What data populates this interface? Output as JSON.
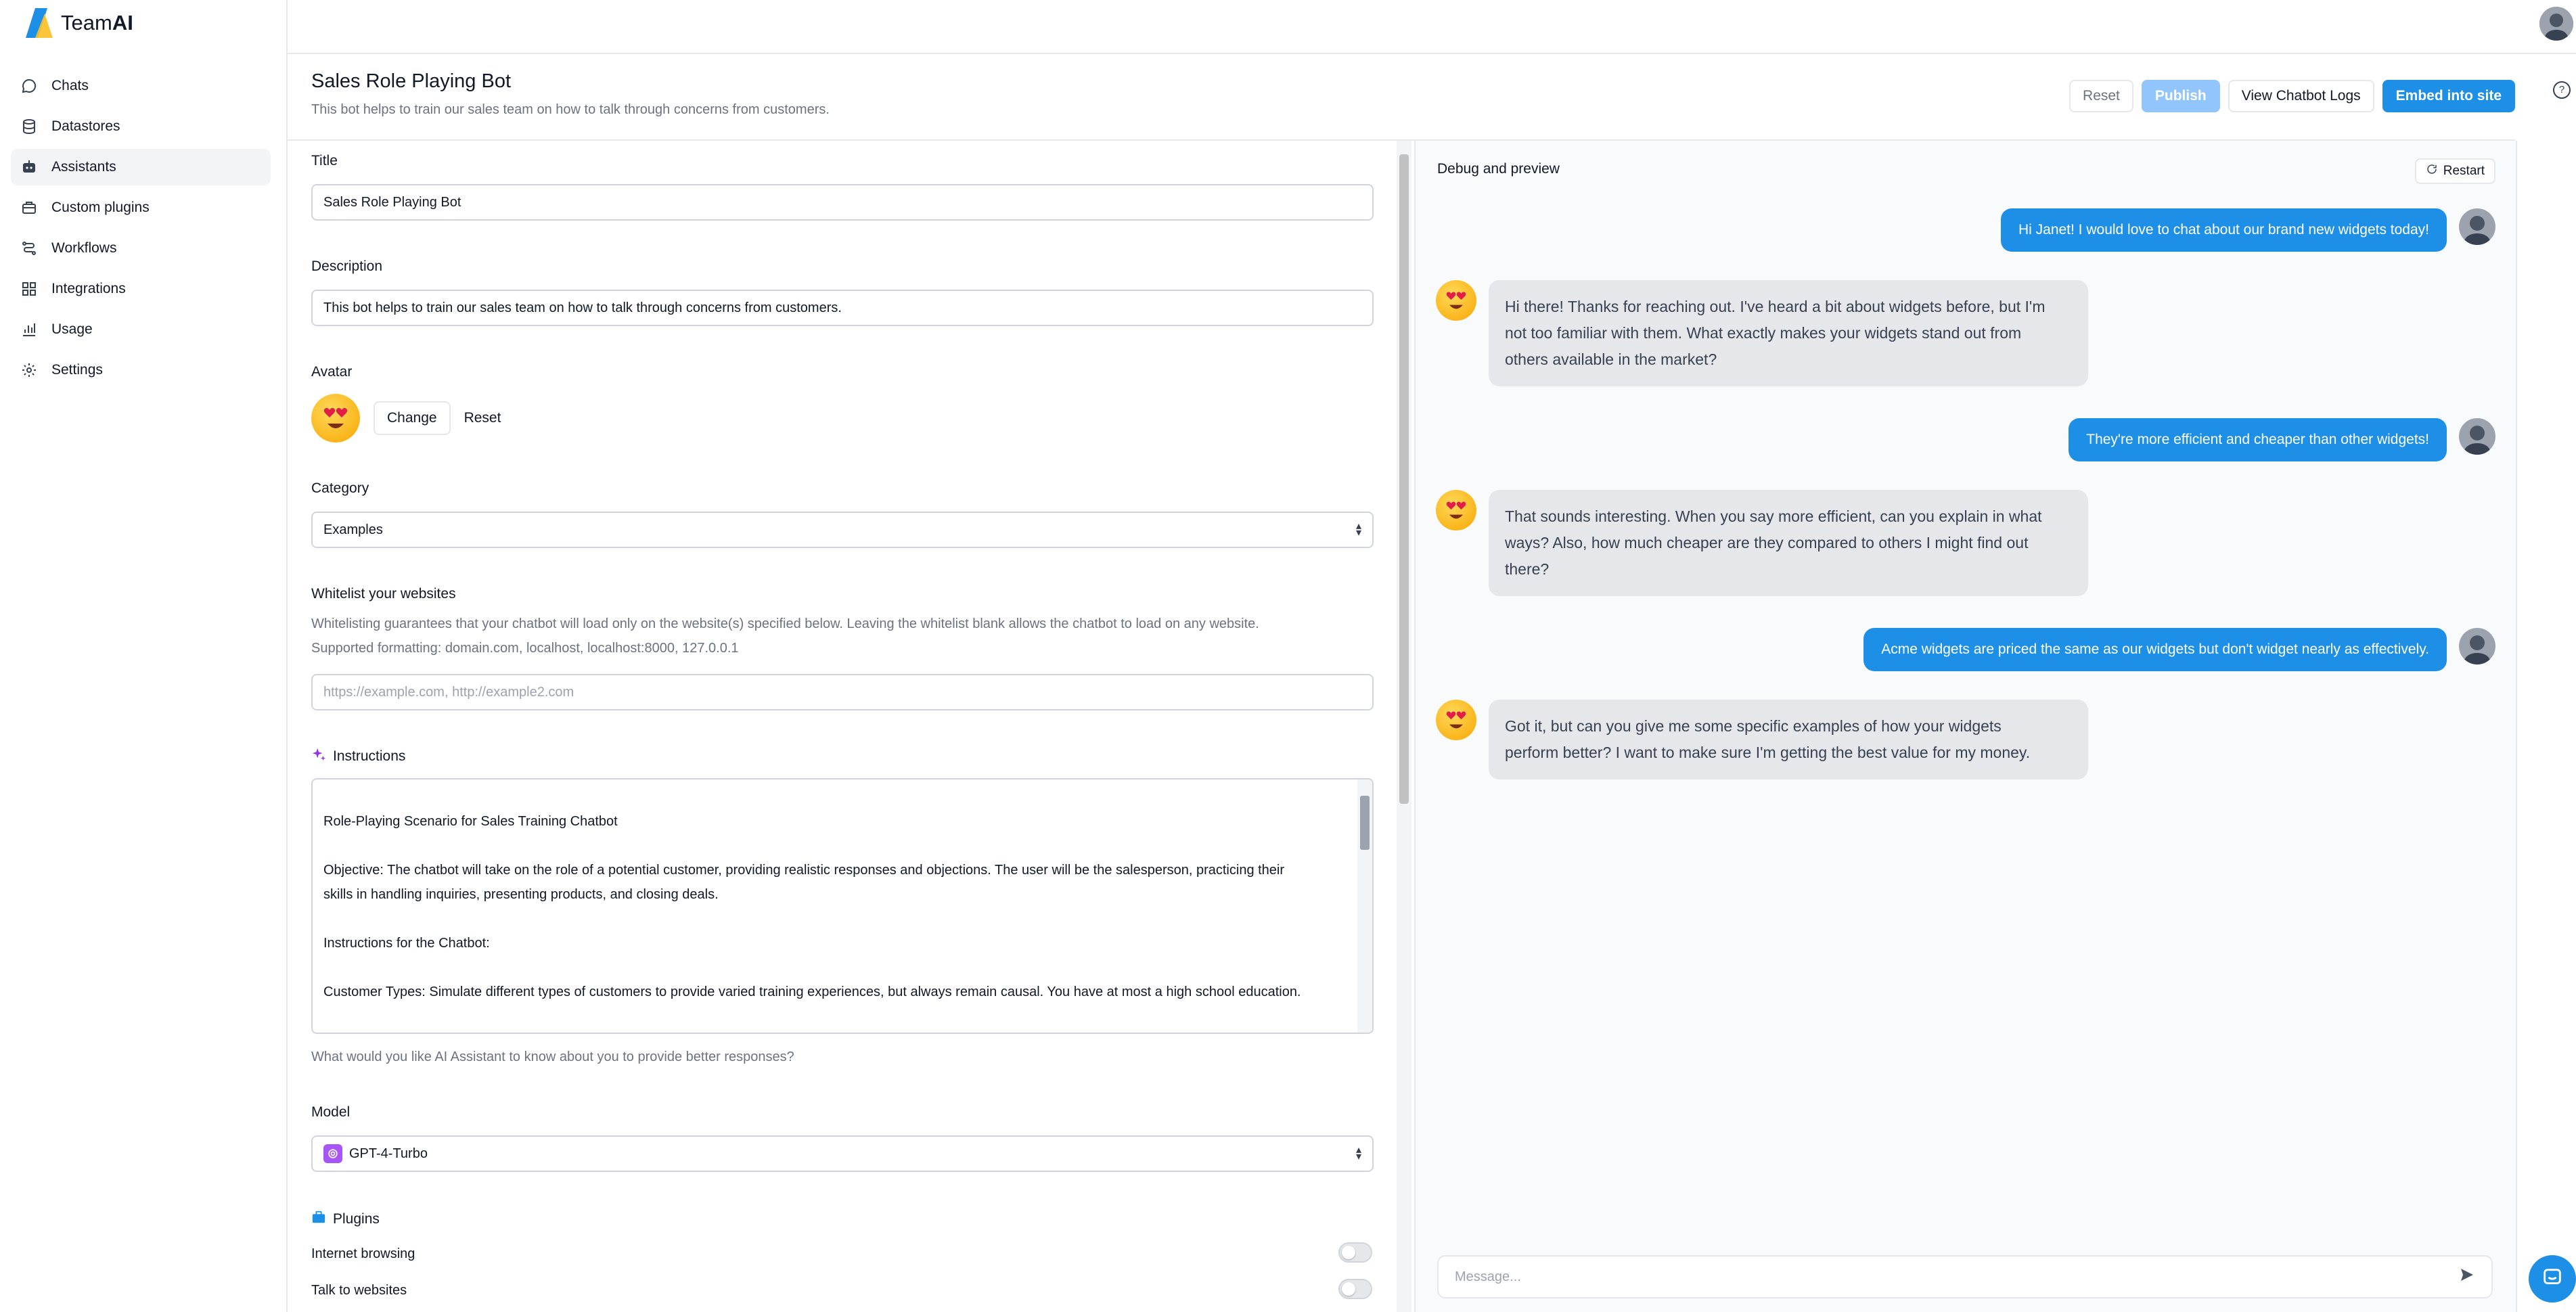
{
  "app": {
    "brand_light": "Team",
    "brand_bold": "AI"
  },
  "sidebar": {
    "items": [
      {
        "label": "Chats",
        "icon": "chat-icon"
      },
      {
        "label": "Datastores",
        "icon": "database-icon"
      },
      {
        "label": "Assistants",
        "icon": "assistant-icon",
        "active": true
      },
      {
        "label": "Custom plugins",
        "icon": "plugin-icon"
      },
      {
        "label": "Workflows",
        "icon": "workflow-icon"
      },
      {
        "label": "Integrations",
        "icon": "grid-icon"
      },
      {
        "label": "Usage",
        "icon": "bar-chart-icon"
      },
      {
        "label": "Settings",
        "icon": "gear-icon"
      }
    ]
  },
  "header": {
    "title": "Sales Role Playing Bot",
    "subtitle": "This bot helps to train our sales team on how to talk through concerns from customers.",
    "reset_label": "Reset",
    "publish_label": "Publish",
    "logs_label": "View Chatbot Logs",
    "embed_label": "Embed into site"
  },
  "form": {
    "title_label": "Title",
    "title_value": "Sales Role Playing Bot",
    "description_label": "Description",
    "description_value": "This bot helps to train our sales team on how to talk through concerns from customers.",
    "avatar_label": "Avatar",
    "avatar_change": "Change",
    "avatar_reset": "Reset",
    "category_label": "Category",
    "category_value": "Examples",
    "whitelist_label": "Whitelist your websites",
    "whitelist_help_1": "Whitelisting guarantees that your chatbot will load only on the website(s) specified below. Leaving the whitelist blank allows the chatbot to load on any website.",
    "whitelist_help_2": "Supported formatting: domain.com, localhost, localhost:8000, 127.0.0.1",
    "whitelist_placeholder": "https://example.com, http://example2.com",
    "instructions_label": "Instructions",
    "instructions_lines": [
      "Role-Playing Scenario for Sales Training Chatbot",
      "Objective: The chatbot will take on the role of a potential customer, providing realistic responses and objections. The user will be the salesperson, practicing their",
      "skills in handling inquiries, presenting products, and closing deals.",
      "Instructions for the Chatbot:",
      "Customer Types: Simulate different types of customers to provide varied training experiences, but always remain causal. You have at most a high school education."
    ],
    "instructions_help": "What would you like AI Assistant to know about you to provide better responses?",
    "model_label": "Model",
    "model_value": "GPT-4-Turbo",
    "plugins_label": "Plugins",
    "plugins": [
      {
        "label": "Internet browsing",
        "enabled": false
      },
      {
        "label": "Talk to websites",
        "enabled": false
      }
    ]
  },
  "preview": {
    "title": "Debug and preview",
    "restart_label": "Restart",
    "messages": [
      {
        "role": "user",
        "text": "Hi Janet! I would love to chat about our brand new widgets today!"
      },
      {
        "role": "bot",
        "lines": [
          "Hi there! Thanks for reaching out. I've heard a bit about widgets before, but I'm",
          "not too familiar with them. What exactly makes your widgets stand out from",
          "others available in the market?"
        ]
      },
      {
        "role": "user",
        "text": "They're more efficient and cheaper than other widgets!"
      },
      {
        "role": "bot",
        "lines": [
          "That sounds interesting. When you say more efficient, can you explain in what",
          "ways? Also, how much cheaper are they compared to others I might find out",
          "there?"
        ]
      },
      {
        "role": "user",
        "text": "Acme widgets are priced the same as our widgets but don't widget nearly as effectively."
      },
      {
        "role": "bot",
        "lines": [
          "Got it, but can you give me some specific examples of how your widgets",
          "perform better? I want to make sure I'm getting the best value for my money."
        ]
      }
    ],
    "composer_placeholder": "Message..."
  },
  "colors": {
    "accent": "#1d8fe6",
    "accent_disabled": "#93c5fd",
    "bot_bubble": "#e5e7eb",
    "emoji_yellow": "#fbbf24"
  }
}
